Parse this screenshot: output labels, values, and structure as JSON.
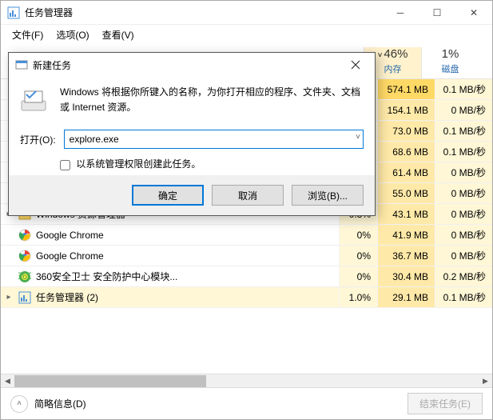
{
  "window": {
    "title": "任务管理器",
    "menu": {
      "file": "文件(F)",
      "options": "选项(O)",
      "view": "查看(V)"
    }
  },
  "columns": {
    "memory": {
      "pct": "46%",
      "label": "内存"
    },
    "disk": {
      "pct": "1%",
      "label": "磁盘"
    }
  },
  "rows": [
    {
      "name": "",
      "cpu": "%",
      "mem": "574.1 MB",
      "disk": "0.1 MB/秒",
      "hot": true,
      "icon": "none",
      "expand": ""
    },
    {
      "name": "",
      "cpu": "%",
      "mem": "154.1 MB",
      "disk": "0 MB/秒",
      "hot": false,
      "icon": "none",
      "expand": ""
    },
    {
      "name": "",
      "cpu": "%",
      "mem": "73.0 MB",
      "disk": "0.1 MB/秒",
      "hot": false,
      "icon": "none",
      "expand": ""
    },
    {
      "name": "",
      "cpu": "%",
      "mem": "68.6 MB",
      "disk": "0.1 MB/秒",
      "hot": false,
      "icon": "none",
      "expand": ""
    },
    {
      "name": "",
      "cpu": "%",
      "mem": "61.4 MB",
      "disk": "0 MB/秒",
      "hot": false,
      "icon": "none",
      "expand": ""
    },
    {
      "name": "",
      "cpu": "%",
      "mem": "55.0 MB",
      "disk": "0 MB/秒",
      "hot": false,
      "icon": "none",
      "expand": ""
    },
    {
      "name": "Windows 资源管理器",
      "cpu": "0.3%",
      "mem": "43.1 MB",
      "disk": "0 MB/秒",
      "hot": false,
      "icon": "folder",
      "expand": "▸"
    },
    {
      "name": "Google Chrome",
      "cpu": "0%",
      "mem": "41.9 MB",
      "disk": "0 MB/秒",
      "hot": false,
      "icon": "chrome",
      "expand": ""
    },
    {
      "name": "Google Chrome",
      "cpu": "0%",
      "mem": "36.7 MB",
      "disk": "0 MB/秒",
      "hot": false,
      "icon": "chrome",
      "expand": ""
    },
    {
      "name": "360安全卫士 安全防护中心模块...",
      "cpu": "0%",
      "mem": "30.4 MB",
      "disk": "0.2 MB/秒",
      "hot": false,
      "icon": "360",
      "expand": ""
    },
    {
      "name": "任务管理器 (2)",
      "cpu": "1.0%",
      "mem": "29.1 MB",
      "disk": "0.1 MB/秒",
      "hot": false,
      "icon": "taskmgr",
      "expand": "▸",
      "sel": true
    }
  ],
  "footer": {
    "brief": "简略信息(D)",
    "end": "结束任务(E)"
  },
  "dialog": {
    "title": "新建任务",
    "message": "Windows 将根据你所键入的名称，为你打开相应的程序、文件夹、文档或 Internet 资源。",
    "open_label": "打开(O):",
    "input_value": "explore.exe",
    "admin_label": "以系统管理权限创建此任务。",
    "ok": "确定",
    "cancel": "取消",
    "browse": "浏览(B)..."
  }
}
